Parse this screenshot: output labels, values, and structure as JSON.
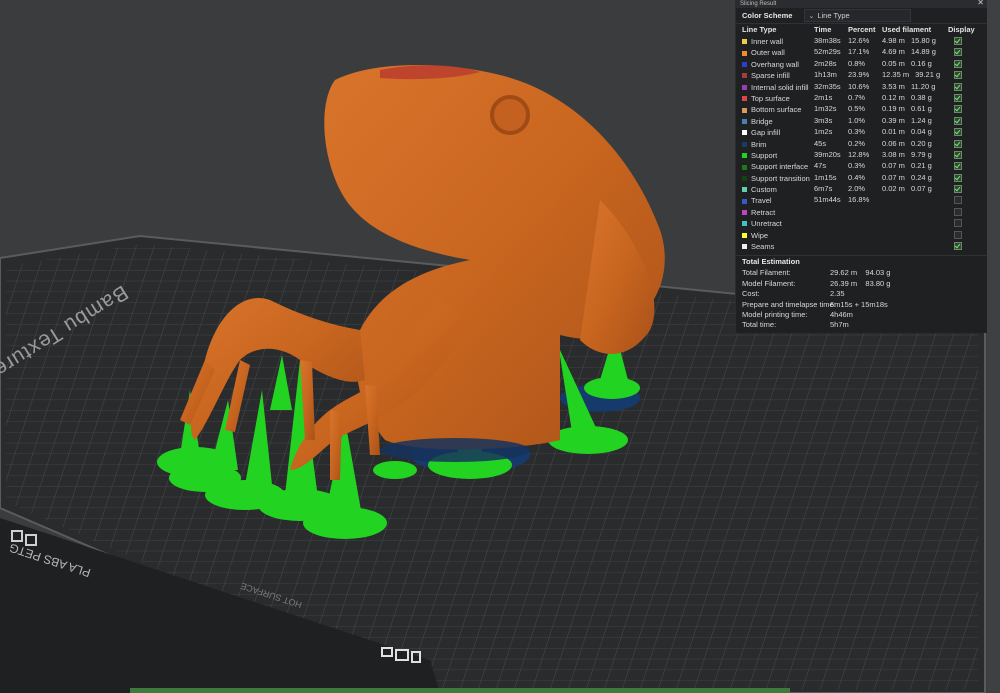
{
  "plate": {
    "name": "Bambu Textured PEI Plate",
    "bottom_label": "PLA ABS PETG",
    "surface_label": "HOT SURFACE"
  },
  "panel": {
    "title": "Slicing Result",
    "close_icon": "close-icon",
    "color_scheme_label": "Color Scheme",
    "color_scheme_value": "Line Type",
    "columns": [
      "Line Type",
      "Time",
      "Percent",
      "Used filament",
      "Display"
    ],
    "line_types": [
      {
        "name": "Inner wall",
        "time": "38m38s",
        "percent": "12.6%",
        "length": "4.98 m",
        "weight": "15.80 g",
        "color": "#f2c94c",
        "display": true
      },
      {
        "name": "Outer wall",
        "time": "52m29s",
        "percent": "17.1%",
        "length": "4.69 m",
        "weight": "14.89 g",
        "color": "#f28c28",
        "display": true
      },
      {
        "name": "Overhang wall",
        "time": "2m28s",
        "percent": "0.8%",
        "length": "0.05 m",
        "weight": "0.16 g",
        "color": "#2b3fcf",
        "display": true
      },
      {
        "name": "Sparse infill",
        "time": "1h13m",
        "percent": "23.9%",
        "length": "12.35 m",
        "weight": "39.21 g",
        "color": "#a83b3b",
        "display": true
      },
      {
        "name": "Internal solid infill",
        "time": "32m35s",
        "percent": "10.6%",
        "length": "3.53 m",
        "weight": "11.20 g",
        "color": "#9b3bb5",
        "display": true
      },
      {
        "name": "Top surface",
        "time": "2m1s",
        "percent": "0.7%",
        "length": "0.12 m",
        "weight": "0.38 g",
        "color": "#e0434d",
        "display": true
      },
      {
        "name": "Bottom surface",
        "time": "1m32s",
        "percent": "0.5%",
        "length": "0.19 m",
        "weight": "0.61 g",
        "color": "#d99a5b",
        "display": true
      },
      {
        "name": "Bridge",
        "time": "3m3s",
        "percent": "1.0%",
        "length": "0.39 m",
        "weight": "1.24 g",
        "color": "#4a7fb5",
        "display": true
      },
      {
        "name": "Gap infill",
        "time": "1m2s",
        "percent": "0.3%",
        "length": "0.01 m",
        "weight": "0.04 g",
        "color": "#ffffff",
        "display": true
      },
      {
        "name": "Brim",
        "time": "45s",
        "percent": "0.2%",
        "length": "0.06 m",
        "weight": "0.20 g",
        "color": "#153a6b",
        "display": true
      },
      {
        "name": "Support",
        "time": "39m20s",
        "percent": "12.8%",
        "length": "3.08 m",
        "weight": "9.79 g",
        "color": "#1fd41f",
        "display": true
      },
      {
        "name": "Support interface",
        "time": "47s",
        "percent": "0.3%",
        "length": "0.07 m",
        "weight": "0.21 g",
        "color": "#1a7a1a",
        "display": true
      },
      {
        "name": "Support transition",
        "time": "1m15s",
        "percent": "0.4%",
        "length": "0.07 m",
        "weight": "0.24 g",
        "color": "#114411",
        "display": true
      },
      {
        "name": "Custom",
        "time": "6m7s",
        "percent": "2.0%",
        "length": "0.02 m",
        "weight": "0.07 g",
        "color": "#5fd1a8",
        "display": true
      },
      {
        "name": "Travel",
        "time": "51m44s",
        "percent": "16.8%",
        "length": "",
        "weight": "",
        "color": "#3a56c8",
        "display": false
      },
      {
        "name": "Retract",
        "time": "",
        "percent": "",
        "length": "",
        "weight": "",
        "color": "#c044c0",
        "display": false
      },
      {
        "name": "Unretract",
        "time": "",
        "percent": "",
        "length": "",
        "weight": "",
        "color": "#44c0c0",
        "display": false
      },
      {
        "name": "Wipe",
        "time": "",
        "percent": "",
        "length": "",
        "weight": "",
        "color": "#ffff33",
        "display": false
      },
      {
        "name": "Seams",
        "time": "",
        "percent": "",
        "length": "",
        "weight": "",
        "color": "#eeeeee",
        "display": true
      }
    ],
    "total_title": "Total Estimation",
    "totals": [
      {
        "label": "Total Filament:",
        "value": "29.62 m    94.03 g"
      },
      {
        "label": "Model Filament:",
        "value": "26.39 m    83.80 g"
      },
      {
        "label": "Cost:",
        "value": "2.35"
      },
      {
        "label": "Prepare and timelapse time:",
        "value": "6m15s + 15m18s"
      },
      {
        "label": "Model printing time:",
        "value": "4h46m"
      },
      {
        "label": "Total time:",
        "value": "5h7m"
      }
    ]
  }
}
